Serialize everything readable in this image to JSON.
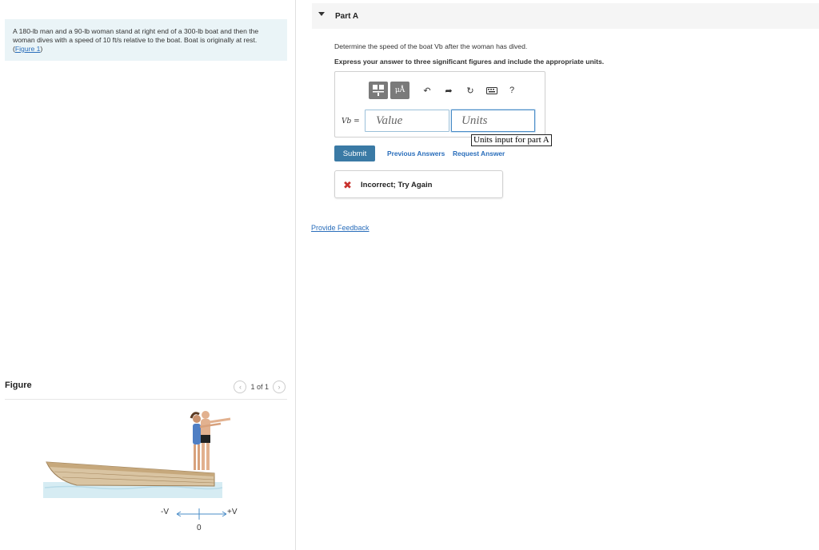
{
  "problem": {
    "text": "A 180-lb man and a 90-lb woman stand at right end of a 300-lb boat and then the woman dives with a speed of 10 ft/s relative to the boat. Boat is originally at rest. (",
    "figure_link": "Figure 1",
    "text_end": ")"
  },
  "figure": {
    "title": "Figure",
    "pager_text": "1 of 1",
    "prev_icon": "chevron-left-icon",
    "next_icon": "chevron-right-icon",
    "axis_neg_label": "-V",
    "axis_pos_label": "+V",
    "axis_origin_label": "0"
  },
  "part": {
    "title": "Part A",
    "question": "Determine the speed of the boat Vb after the woman has dived.",
    "instruction": "Express your answer to three significant figures and include the appropriate units."
  },
  "answer": {
    "var_label": "Vb",
    "eq": "=",
    "value_placeholder": "Value",
    "units_placeholder": "Units",
    "units_tooltip": "Units input for part A",
    "toolbar": {
      "units_btn": "μÅ",
      "help": "?"
    }
  },
  "actions": {
    "submit": "Submit",
    "previous_answers": "Previous Answers",
    "request_answer": "Request Answer"
  },
  "feedback": {
    "icon": "x-mark-icon",
    "text": "Incorrect; Try Again",
    "error_color": "#c8322e"
  },
  "provide_feedback": "Provide Feedback",
  "colors": {
    "link": "#2a6ebb",
    "submit_bg": "#3a7aa5",
    "problem_bg": "#eaf4f7"
  }
}
